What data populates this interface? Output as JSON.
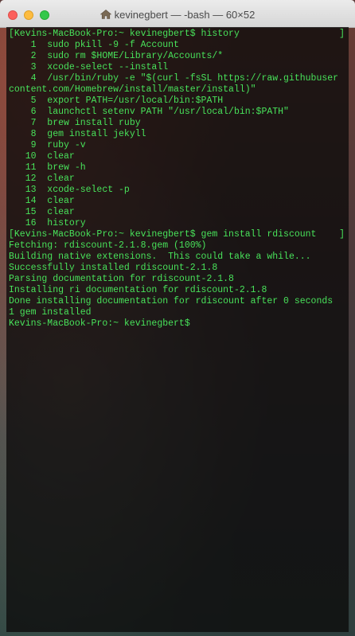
{
  "window": {
    "title": "kevinegbert — -bash — 60×52"
  },
  "terminal": {
    "lines": [
      "[Kevins-MacBook-Pro:~ kevinegbert$ history",
      "    1  sudo pkill -9 -f Account",
      "    2  sudo rm $HOME/Library/Accounts/*",
      "    3  xcode-select --install",
      "    4  /usr/bin/ruby -e \"$(curl -fsSL https://raw.githubuser",
      "content.com/Homebrew/install/master/install)\"",
      "    5  export PATH=/usr/local/bin:$PATH",
      "    6  launchctl setenv PATH \"/usr/local/bin:$PATH\"",
      "    7  brew install ruby",
      "    8  gem install jekyll",
      "    9  ruby -v",
      "   10  clear",
      "   11  brew -h",
      "   12  clear",
      "   13  xcode-select -p",
      "   14  clear",
      "   15  clear",
      "   16  history",
      "[Kevins-MacBook-Pro:~ kevinegbert$ gem install rdiscount",
      "Fetching: rdiscount-2.1.8.gem (100%)",
      "Building native extensions.  This could take a while...",
      "Successfully installed rdiscount-2.1.8",
      "Parsing documentation for rdiscount-2.1.8",
      "Installing ri documentation for rdiscount-2.1.8",
      "Done installing documentation for rdiscount after 0 seconds",
      "1 gem installed",
      "Kevins-MacBook-Pro:~ kevinegbert$ "
    ],
    "bracket": "]"
  },
  "colors": {
    "terminal_text": "#48e25a",
    "close": "#fc605c",
    "minimize": "#fdbc40",
    "zoom": "#34c84a"
  }
}
